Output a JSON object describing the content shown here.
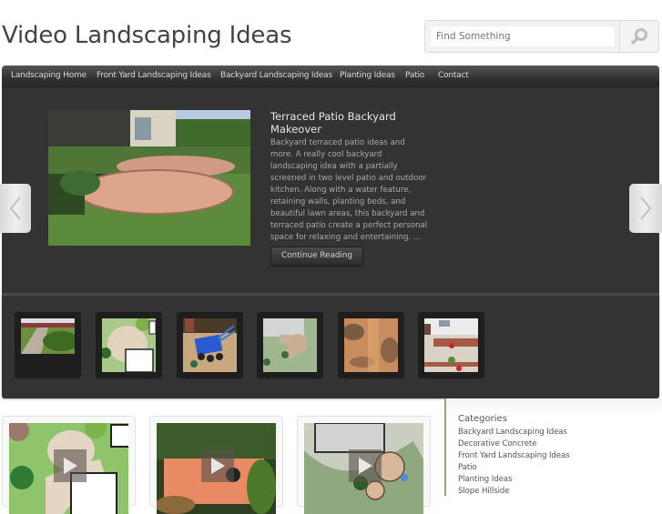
{
  "header": {
    "site_title": "Video Landscaping Ideas",
    "search": {
      "placeholder": "Find Something",
      "button_icon": "search-icon"
    }
  },
  "nav": {
    "items": [
      {
        "label": "Landscaping Home"
      },
      {
        "label": "Front Yard Landscaping Ideas"
      },
      {
        "label": "Backyard Landscaping Ideas"
      },
      {
        "label": "Planting Ideas"
      },
      {
        "label": "Patio"
      },
      {
        "label": "Contact"
      }
    ]
  },
  "featured": {
    "title": "Terraced Patio Backyard Makeover",
    "excerpt": "Backyard terraced patio ideas and more. A really cool backyard landscaping idea with a partially screened in two level  patio and outdoor kitchen. Along with a water feature, retaining walls, planting beds, and beautiful lawn areas, this backyard and terraced patio create a perfect personal space for relaxing and entertaining. …",
    "button_label": "Continue Reading",
    "image_alt": "terraced patio backyard photo",
    "prev_icon": "chevron-left-icon",
    "next_icon": "chevron-right-icon"
  },
  "thumbnails": [
    {
      "alt": "garden path with hedges"
    },
    {
      "alt": "landscape plan drawing"
    },
    {
      "alt": "blue excavator machine"
    },
    {
      "alt": "backyard patio plan"
    },
    {
      "alt": "flagstone path"
    },
    {
      "alt": "front yard rock garden"
    }
  ],
  "sidebar": {
    "heading": "Categories",
    "categories": [
      "Backyard Landscaping Ideas",
      "Decorative Concrete",
      "Front Yard Landscaping Ideas",
      "Patio",
      "Planting Ideas",
      "Slope Hillside"
    ]
  },
  "videos": [
    {
      "alt": "landscape plan video",
      "play_icon": "play-icon"
    },
    {
      "alt": "orange wall garden video",
      "play_icon": "play-icon"
    },
    {
      "alt": "backyard design plan video",
      "play_icon": "play-icon"
    }
  ],
  "colors": {
    "nav_bg": "#333333",
    "featured_bg": "#333333",
    "sidebar_accent": "#8aaa7a",
    "text": "#555555"
  }
}
